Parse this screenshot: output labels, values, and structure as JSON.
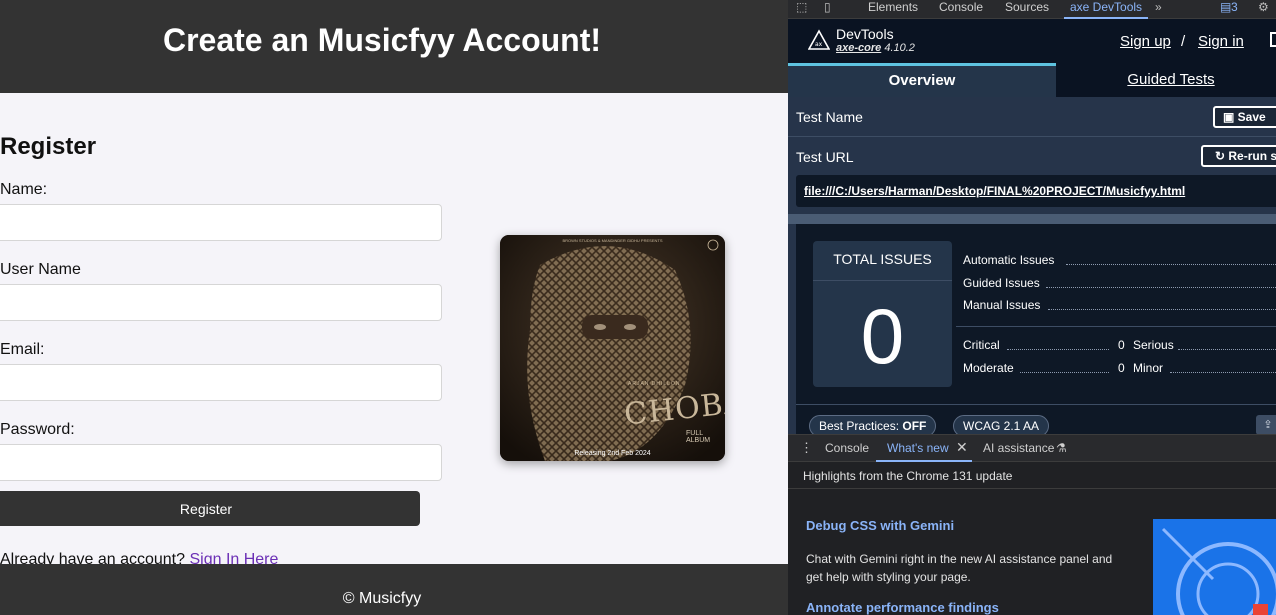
{
  "page": {
    "title": "Create an Musicfyy Account!",
    "form_heading": "Register",
    "fields": [
      {
        "label": "Name:",
        "value": ""
      },
      {
        "label": "User Name",
        "value": ""
      },
      {
        "label": "Email:",
        "value": ""
      },
      {
        "label": "Password:",
        "value": ""
      }
    ],
    "register_button": "Register",
    "already_text": "Already have an account?",
    "signin_link": "Sign In Here",
    "footer": "© Musicfyy",
    "album": {
      "title": "CHOBAR",
      "subtitle": "FULL ALBUM",
      "release": "Releasing 2nd Feb 2024",
      "artist": "ARJAN DHILLON",
      "top_text": "BROWN STUDIOS & MANDINDER GIDHU PRESENTS"
    }
  },
  "devtools": {
    "tabs": [
      "Elements",
      "Console",
      "Sources",
      "axe DevTools"
    ],
    "active_tab": "axe DevTools",
    "issue_badge": "3",
    "axe": {
      "name": "DevTools",
      "version_product": "axe-core",
      "version_number": "4.10.2",
      "sign_up": "Sign up",
      "separator": "/",
      "sign_in": "Sign in",
      "tab_overview": "Overview",
      "tab_guided": "Guided Tests",
      "test_name_label": "Test Name",
      "save_button": "Save",
      "test_url_label": "Test URL",
      "rerun_button": "Re-run s",
      "test_url": "file:///C:/Users/Harman/Desktop/FINAL%20PROJECT/Musicfyy.html",
      "total_issues_label": "TOTAL ISSUES",
      "total_issues": "0",
      "issue_types": [
        "Automatic Issues",
        "Guided Issues",
        "Manual Issues"
      ],
      "critical_label": "Critical",
      "critical_value": "0",
      "serious_label": "Serious",
      "moderate_label": "Moderate",
      "moderate_value": "0",
      "minor_label": "Minor",
      "best_practices_label": "Best Practices:",
      "best_practices_value": "OFF",
      "wcag_label": "WCAG 2.1 AA"
    },
    "drawer": {
      "tabs": [
        "Console",
        "What's new",
        "AI assistance"
      ],
      "active_tab": "What's new",
      "highlights": "Highlights from the Chrome 131 update",
      "items": [
        {
          "title": "Debug CSS with Gemini",
          "body": "Chat with Gemini right in the new AI assistance panel and get help with styling your page."
        },
        {
          "title": "Annotate performance findings",
          "body": ""
        }
      ]
    }
  }
}
